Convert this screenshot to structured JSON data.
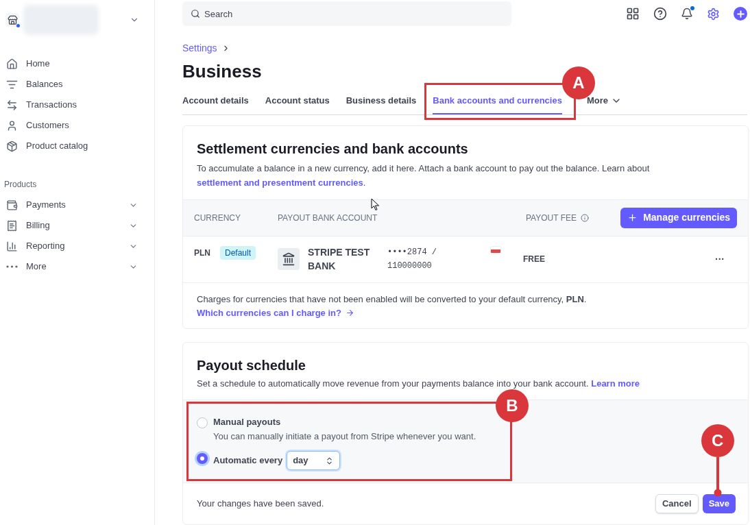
{
  "sidebar": {
    "nav": [
      {
        "label": "Home"
      },
      {
        "label": "Balances"
      },
      {
        "label": "Transactions"
      },
      {
        "label": "Customers"
      },
      {
        "label": "Product catalog"
      }
    ],
    "section_title": "Products",
    "products": [
      {
        "label": "Payments",
        "expanded": false
      },
      {
        "label": "Billing",
        "expanded": false
      },
      {
        "label": "Reporting",
        "expanded": false
      },
      {
        "label": "More",
        "expanded": false
      }
    ]
  },
  "top_bar": {
    "search": {
      "placeholder": "Search"
    },
    "notifications_unread": true
  },
  "breadcrumb": "Settings",
  "title": "Business",
  "tabs": [
    {
      "label": "Account details",
      "selected": false
    },
    {
      "label": "Account status",
      "selected": false
    },
    {
      "label": "Business details",
      "selected": false
    },
    {
      "label": "Bank accounts and currencies",
      "selected": true
    },
    {
      "label": "More",
      "selected": false,
      "kind": "menu"
    }
  ],
  "settlement": {
    "heading": "Settlement currencies and bank accounts",
    "description": "To accumulate a balance in a new currency, add it here. Attach a bank account to pay out the balance. Learn about",
    "link": "settlement and presentment currencies",
    "link_end": ".",
    "columns": [
      "CURRENCY",
      "PAYOUT BANK ACCOUNT",
      "PAYOUT FEE"
    ],
    "manage_button": "Manage currencies",
    "rows": [
      {
        "currency": "PLN",
        "badge": "Default",
        "bank": "STRIPE TEST BANK",
        "account": "••••2874 / 110000000",
        "fee": "FREE",
        "menu": "···"
      }
    ],
    "note": "Charges for currencies that have not been enabled will be converted to your default currency, **PLN**.",
    "note_link": "Which currencies can I charge in?"
  },
  "payout": {
    "heading": "Payout schedule",
    "description": "Set a schedule to automatically move revenue from your payments balance into your bank account.",
    "link": "Learn more",
    "options": [
      {
        "label": "Manual payouts",
        "hint": "You can manually initiate a payout from Stripe whenever you want.",
        "selected": false
      },
      {
        "label": "Automatic every",
        "selected": true,
        "interval": "day"
      }
    ],
    "status": "Your changes have been saved.",
    "cancel": "Cancel",
    "save": "Save"
  },
  "annotations": [
    {
      "label": "A",
      "kind": "box"
    },
    {
      "label": "B",
      "kind": "box"
    },
    {
      "label": "C",
      "kind": "pin"
    }
  ]
}
